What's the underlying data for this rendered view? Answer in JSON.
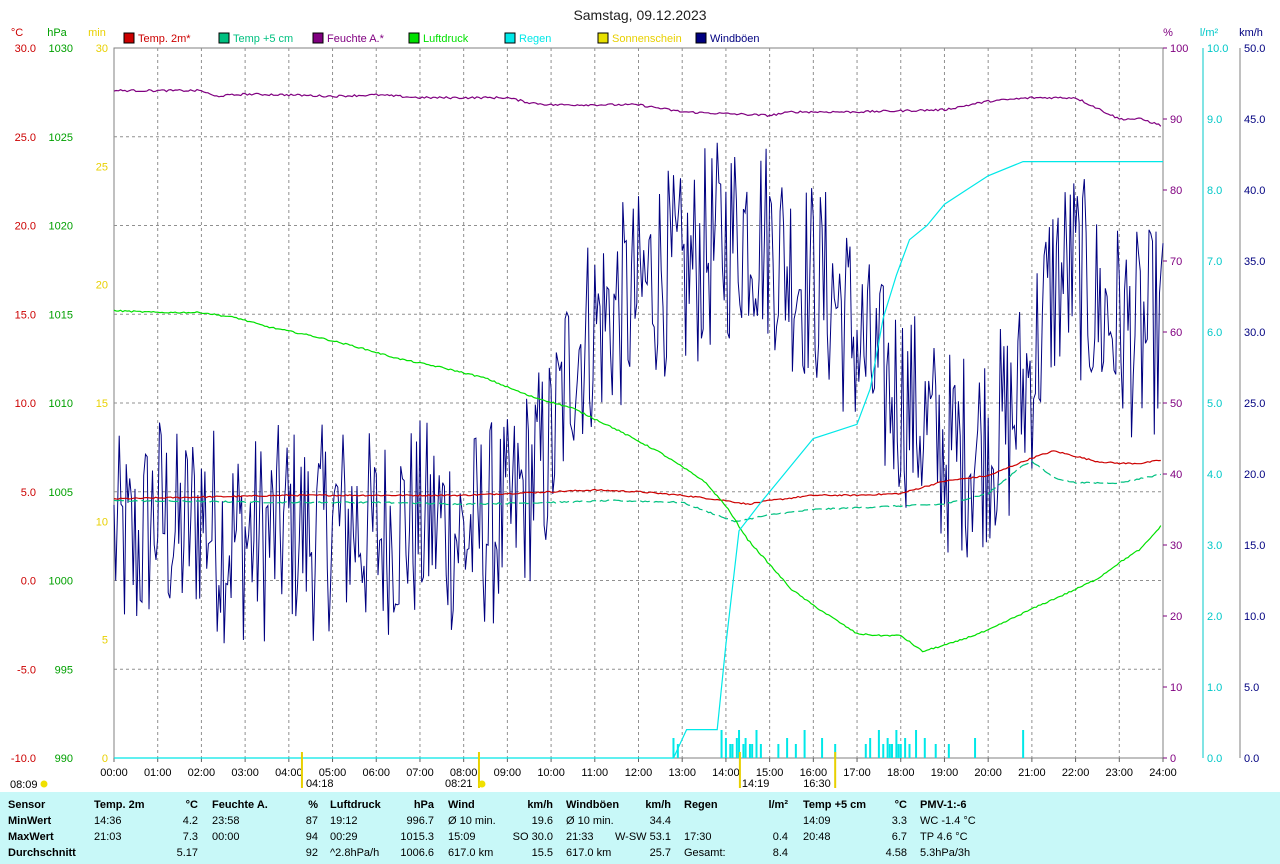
{
  "chart_data": {
    "type": "line",
    "title": "Samstag, 09.12.2023",
    "x_ticks": [
      "00:00",
      "01:00",
      "02:00",
      "03:00",
      "04:00",
      "05:00",
      "06:00",
      "07:00",
      "08:00",
      "09:00",
      "10:00",
      "11:00",
      "12:00",
      "13:00",
      "14:00",
      "15:00",
      "16:00",
      "17:00",
      "18:00",
      "19:00",
      "20:00",
      "21:00",
      "22:00",
      "23:00",
      "24:00"
    ],
    "x_range_hours": [
      0,
      24
    ],
    "grid": true,
    "legend_position": "top",
    "axes": {
      "temp": {
        "unit": "°C",
        "range": [
          -10,
          30
        ],
        "ticks": [
          "30.0",
          "25.0",
          "20.0",
          "15.0",
          "10.0",
          "5.0",
          "0.0",
          "-5.0",
          "-10.0"
        ],
        "color": "#cc0000"
      },
      "press": {
        "unit": "hPa",
        "range": [
          990,
          1030
        ],
        "ticks": [
          "1030",
          "1025",
          "1020",
          "1015",
          "1010",
          "1005",
          "1000",
          "995",
          "990"
        ],
        "color": "#00a000"
      },
      "sun": {
        "unit": "min",
        "range": [
          0,
          30
        ],
        "ticks": [
          "30",
          "25",
          "20",
          "15",
          "10",
          "5",
          "0"
        ],
        "color": "#e8d000"
      },
      "hum": {
        "unit": "%",
        "range": [
          0,
          100
        ],
        "ticks": [
          "100",
          "90",
          "80",
          "70",
          "60",
          "50",
          "40",
          "30",
          "20",
          "10",
          "0"
        ],
        "color": "#800080"
      },
      "rain": {
        "unit": "l/m²",
        "range": [
          0,
          10
        ],
        "ticks": [
          "10.0",
          "9.0",
          "8.0",
          "7.0",
          "6.0",
          "5.0",
          "4.0",
          "3.0",
          "2.0",
          "1.0",
          "0.0"
        ],
        "color": "#00c8c8"
      },
      "wind": {
        "unit": "km/h",
        "range": [
          0,
          50
        ],
        "ticks": [
          "50.0",
          "45.0",
          "40.0",
          "35.0",
          "30.0",
          "25.0",
          "20.0",
          "15.0",
          "10.0",
          "5.0",
          "0.0"
        ],
        "color": "#000080"
      }
    },
    "series": [
      {
        "name": "Temp. 2m*",
        "axis": "temp",
        "color": "#cc0000",
        "points": [
          [
            0,
            4.6
          ],
          [
            2,
            4.7
          ],
          [
            4,
            4.8
          ],
          [
            6,
            4.8
          ],
          [
            8,
            4.8
          ],
          [
            10,
            5.0
          ],
          [
            11,
            5.1
          ],
          [
            12,
            5.0
          ],
          [
            13,
            4.8
          ],
          [
            14,
            4.5
          ],
          [
            14.5,
            4.3
          ],
          [
            15,
            4.5
          ],
          [
            16,
            4.8
          ],
          [
            17,
            4.8
          ],
          [
            18,
            4.9
          ],
          [
            19,
            5.6
          ],
          [
            20,
            5.9
          ],
          [
            21,
            6.9
          ],
          [
            21.5,
            7.3
          ],
          [
            22,
            7.0
          ],
          [
            22.5,
            6.7
          ],
          [
            23,
            6.6
          ],
          [
            23.5,
            6.6
          ],
          [
            24,
            6.8
          ]
        ]
      },
      {
        "name": "Temp +5 cm",
        "axis": "temp",
        "color": "#00c080",
        "dashed": true,
        "points": [
          [
            0,
            4.5
          ],
          [
            4,
            4.4
          ],
          [
            6,
            4.4
          ],
          [
            8,
            4.3
          ],
          [
            10,
            4.4
          ],
          [
            11.5,
            4.5
          ],
          [
            13,
            4.4
          ],
          [
            14,
            3.5
          ],
          [
            14.2,
            3.3
          ],
          [
            15,
            3.7
          ],
          [
            16,
            4.0
          ],
          [
            17,
            4.1
          ],
          [
            18,
            4.2
          ],
          [
            19,
            4.3
          ],
          [
            20,
            4.9
          ],
          [
            20.8,
            6.5
          ],
          [
            21,
            6.7
          ],
          [
            21.5,
            5.8
          ],
          [
            22,
            5.5
          ],
          [
            23,
            5.5
          ],
          [
            24,
            6.0
          ]
        ]
      },
      {
        "name": "Feuchte A.*",
        "axis": "hum",
        "color": "#800080",
        "points": [
          [
            0,
            94
          ],
          [
            2,
            94
          ],
          [
            2.3,
            93.2
          ],
          [
            3,
            93.5
          ],
          [
            4,
            93.4
          ],
          [
            5,
            93.2
          ],
          [
            6,
            93.4
          ],
          [
            7,
            93
          ],
          [
            9,
            93
          ],
          [
            9.5,
            92.3
          ],
          [
            10,
            92
          ],
          [
            12,
            92
          ],
          [
            13,
            91
          ],
          [
            15,
            90.5
          ],
          [
            15.5,
            91
          ],
          [
            17,
            91
          ],
          [
            19,
            91.3
          ],
          [
            20,
            92.5
          ],
          [
            21,
            93
          ],
          [
            22,
            93
          ],
          [
            22.5,
            91.5
          ],
          [
            23,
            90
          ],
          [
            23.5,
            90
          ],
          [
            24,
            89
          ]
        ]
      },
      {
        "name": "Luftdruck",
        "axis": "press",
        "color": "#00e000",
        "points": [
          [
            0,
            1015.2
          ],
          [
            1,
            1015.1
          ],
          [
            2,
            1015.1
          ],
          [
            2.8,
            1014.8
          ],
          [
            3.5,
            1014.3
          ],
          [
            4.5,
            1013.8
          ],
          [
            5.5,
            1013.2
          ],
          [
            6.5,
            1012.5
          ],
          [
            7.5,
            1012.0
          ],
          [
            8.5,
            1011.4
          ],
          [
            9.5,
            1010.4
          ],
          [
            10.5,
            1009.7
          ],
          [
            11.5,
            1008.5
          ],
          [
            12.5,
            1007.2
          ],
          [
            13.5,
            1005.6
          ],
          [
            14,
            1004.2
          ],
          [
            14.5,
            1002.3
          ],
          [
            15,
            1000.9
          ],
          [
            15.5,
            999.5
          ],
          [
            16,
            998.6
          ],
          [
            16.5,
            997.8
          ],
          [
            17,
            997.0
          ],
          [
            17.5,
            996.9
          ],
          [
            18,
            996.9
          ],
          [
            18.5,
            996.0
          ],
          [
            19.2,
            996.5
          ],
          [
            20,
            997.2
          ],
          [
            20.5,
            997.8
          ],
          [
            21,
            998.4
          ],
          [
            22,
            999.5
          ],
          [
            22.5,
            1000.1
          ],
          [
            23,
            1001.0
          ],
          [
            23.5,
            1001.8
          ],
          [
            24,
            1003.2
          ]
        ]
      },
      {
        "name": "Regen",
        "axis": "rain",
        "color": "#00e8e8",
        "points": [
          [
            0,
            0
          ],
          [
            12.8,
            0
          ],
          [
            13.1,
            0.4
          ],
          [
            13.8,
            0.4
          ],
          [
            14,
            1.6
          ],
          [
            14.3,
            3.2
          ],
          [
            14.8,
            3.6
          ],
          [
            15.2,
            3.9
          ],
          [
            15.6,
            4.2
          ],
          [
            16,
            4.5
          ],
          [
            16.5,
            4.6
          ],
          [
            17,
            4.7
          ],
          [
            17.3,
            5.2
          ],
          [
            17.6,
            6.2
          ],
          [
            17.9,
            6.8
          ],
          [
            18.2,
            7.3
          ],
          [
            18.6,
            7.5
          ],
          [
            19,
            7.8
          ],
          [
            19.5,
            8.0
          ],
          [
            20,
            8.2
          ],
          [
            20.8,
            8.4
          ],
          [
            21,
            8.4
          ],
          [
            24,
            8.4
          ]
        ]
      },
      {
        "name": "Sonnenschein",
        "axis": "sun",
        "color": "#e8e000",
        "points": []
      },
      {
        "name": "Windböen",
        "axis": "wind",
        "color": "#000080",
        "points": [
          [
            0,
            14
          ],
          [
            0.5,
            13
          ],
          [
            1,
            16
          ],
          [
            1.5,
            14
          ],
          [
            2,
            16
          ],
          [
            2.5,
            14
          ],
          [
            3,
            14
          ],
          [
            3.5,
            14
          ],
          [
            4,
            15
          ],
          [
            4.5,
            14
          ],
          [
            5,
            15
          ],
          [
            5.5,
            15
          ],
          [
            6,
            14
          ],
          [
            6.5,
            15
          ],
          [
            7,
            15
          ],
          [
            7.5,
            15
          ],
          [
            8,
            14
          ],
          [
            8.5,
            15
          ],
          [
            9,
            15
          ],
          [
            9.5,
            18
          ],
          [
            10,
            20
          ],
          [
            10.5,
            27
          ],
          [
            11,
            29
          ],
          [
            11.5,
            30
          ],
          [
            12,
            31
          ],
          [
            12.5,
            33
          ],
          [
            13,
            32
          ],
          [
            13.5,
            34
          ],
          [
            14,
            35
          ],
          [
            14.5,
            36
          ],
          [
            15,
            35
          ],
          [
            15.5,
            33
          ],
          [
            16,
            32
          ],
          [
            16.5,
            31
          ],
          [
            17,
            28
          ],
          [
            17.5,
            25
          ],
          [
            18,
            24
          ],
          [
            18.5,
            22
          ],
          [
            19,
            20
          ],
          [
            19.5,
            20
          ],
          [
            20,
            21
          ],
          [
            20.5,
            22
          ],
          [
            21,
            26
          ],
          [
            21.5,
            32
          ],
          [
            22,
            33
          ],
          [
            22.5,
            30
          ],
          [
            23,
            29
          ],
          [
            23.5,
            28
          ],
          [
            24,
            29
          ]
        ],
        "envelope_low_offset": 6,
        "envelope_high_offset": 9
      }
    ],
    "annotations": {
      "sunrise": "08:09",
      "tick_04": "04:18",
      "tick_08": "08:21",
      "tick_14": "14:19",
      "sunset": "16:30"
    }
  },
  "stats": {
    "headers": [
      "Sensor",
      "Temp. 2m",
      "°C",
      "Feuchte A.",
      "%",
      "Luftdruck",
      "hPa",
      "Wind",
      "km/h",
      "Windböen",
      "km/h",
      "Regen",
      "l/m²",
      "Temp +5 cm",
      "°C",
      "PMV-1:-6"
    ],
    "rows": [
      [
        "MinWert",
        "14:36",
        "4.2",
        "23:58",
        "87",
        "19:12",
        "996.7",
        "Ø 10 min.",
        "19.6",
        "Ø 10 min.",
        "34.4",
        "",
        "",
        "14:09",
        "3.3",
        "WC -1.4 °C"
      ],
      [
        "MaxWert",
        "21:03",
        "7.3",
        "00:00",
        "94",
        "00:29",
        "1015.3",
        "15:09",
        "SO 30.0",
        "21:33",
        "W-SW 53.1",
        "17:30",
        "0.4",
        "20:48",
        "6.7",
        "TP 4.6 °C"
      ],
      [
        "Durchschnitt",
        "",
        "5.17",
        "",
        "92",
        "^2.8hPa/h",
        "1006.6",
        "617.0 km",
        "15.5",
        "617.0 km",
        "25.7",
        "Gesamt:",
        "8.4",
        "",
        "4.58",
        "5.3hPa/3h"
      ]
    ]
  }
}
